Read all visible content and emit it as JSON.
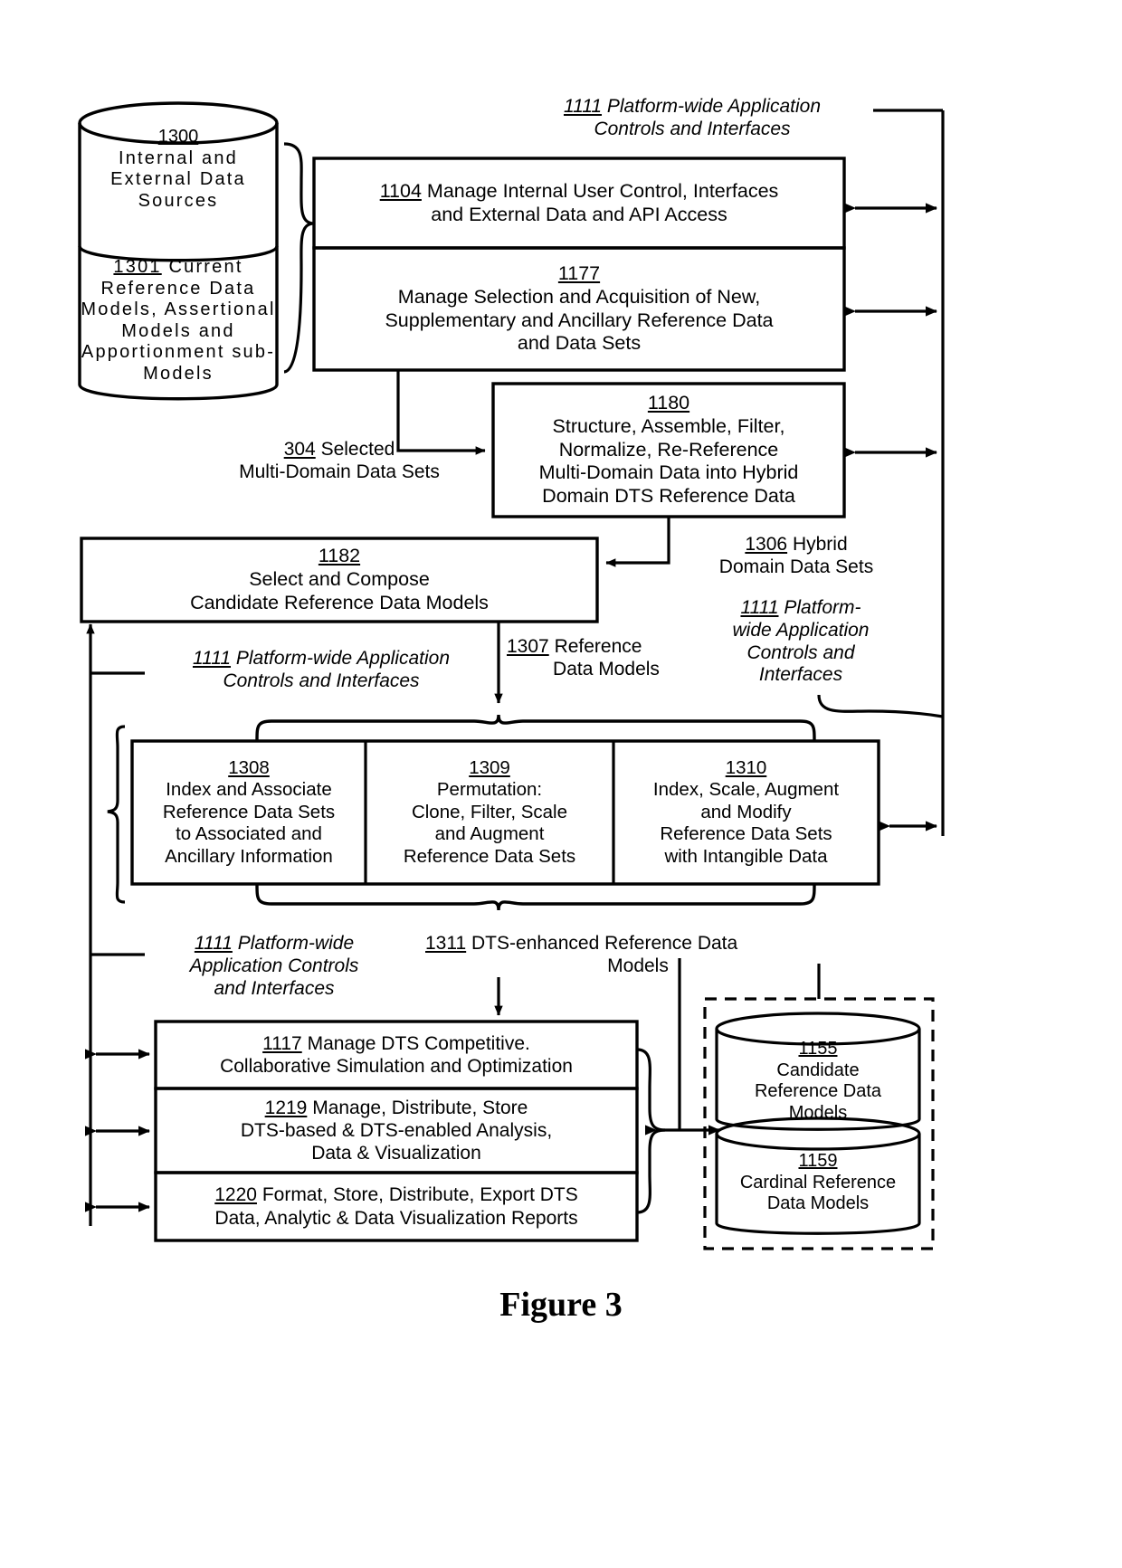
{
  "figure": {
    "caption": "Figure 3"
  },
  "datastores": {
    "sources_top": {
      "ref": "1300",
      "text": "Internal and External Data Sources"
    },
    "sources_bottom": {
      "ref": "1301",
      "text": "Current Reference Data Models, Assertional Models and Apportionment sub-Models"
    },
    "candidate_models": {
      "ref": "1155",
      "line1": "Candidate",
      "line2": "Reference Data",
      "line3": "Models"
    },
    "cardinal_models": {
      "ref": "1159",
      "line1": "Cardinal Reference",
      "line2": "Data Models"
    }
  },
  "blocks": {
    "b1104": {
      "ref": "1104",
      "line1": "Manage Internal User Control, Interfaces",
      "line2": "and External Data and API Access"
    },
    "b1177": {
      "ref": "1177",
      "line1": "Manage Selection and Acquisition of New,",
      "line2": "Supplementary and Ancillary Reference Data",
      "line3": "and Data Sets"
    },
    "b1180": {
      "ref": "1180",
      "line1": "Structure, Assemble, Filter,",
      "line2": "Normalize, Re-Reference",
      "line3": "Multi-Domain Data into Hybrid",
      "line4": "Domain DTS Reference Data"
    },
    "b1182": {
      "ref": "1182",
      "line1": "Select and Compose",
      "line2": "Candidate Reference Data Models"
    },
    "b1308": {
      "ref": "1308",
      "line1": "Index and Associate",
      "line2": "Reference Data Sets",
      "line3": "to Associated and",
      "line4": "Ancillary Information"
    },
    "b1309": {
      "ref": "1309",
      "line1": "Permutation:",
      "line2": "Clone, Filter, Scale",
      "line3": "and Augment",
      "line4": "Reference Data Sets"
    },
    "b1310": {
      "ref": "1310",
      "line1": "Index, Scale, Augment",
      "line2": "and Modify",
      "line3": "Reference Data Sets",
      "line4": "with Intangible Data"
    },
    "b1117": {
      "ref": "1117",
      "line1": "Manage DTS Competitive.",
      "line2": "Collaborative Simulation and Optimization"
    },
    "b1219": {
      "ref": "1219",
      "line1": "Manage, Distribute, Store",
      "line2": "DTS-based & DTS-enabled Analysis,",
      "line3": "Data & Visualization"
    },
    "b1220": {
      "ref": "1220",
      "line1": "Format, Store, Distribute, Export DTS",
      "line2": "Data, Analytic & Data Visualization Reports"
    }
  },
  "flow_labels": {
    "l1111_top": {
      "ref": "1111",
      "line1": "Platform-wide Application",
      "line2": "Controls and Interfaces"
    },
    "l304": {
      "ref": "304",
      "line1": "Selected",
      "line2": "Multi-Domain Data Sets"
    },
    "l1306": {
      "ref": "1306",
      "line1": "Hybrid",
      "line2": "Domain Data Sets"
    },
    "l1111_right": {
      "ref": "1111",
      "line1": "Platform-",
      "line2": "wide Application",
      "line3": "Controls and",
      "line4": "Interfaces"
    },
    "l1111_mid": {
      "ref": "1111",
      "line1": "Platform-wide Application",
      "line2": "Controls and Interfaces"
    },
    "l1307": {
      "ref": "1307",
      "line1": "Reference",
      "line2": "Data Models"
    },
    "l1111_low": {
      "ref": "1111",
      "line1": "Platform-wide",
      "line2": "Application Controls",
      "line3": "and Interfaces"
    },
    "l1311": {
      "ref": "1311",
      "line1": "DTS-enhanced Reference Data",
      "line2": "Models"
    }
  },
  "colors": {
    "stroke": "#000000",
    "background": "#ffffff"
  }
}
